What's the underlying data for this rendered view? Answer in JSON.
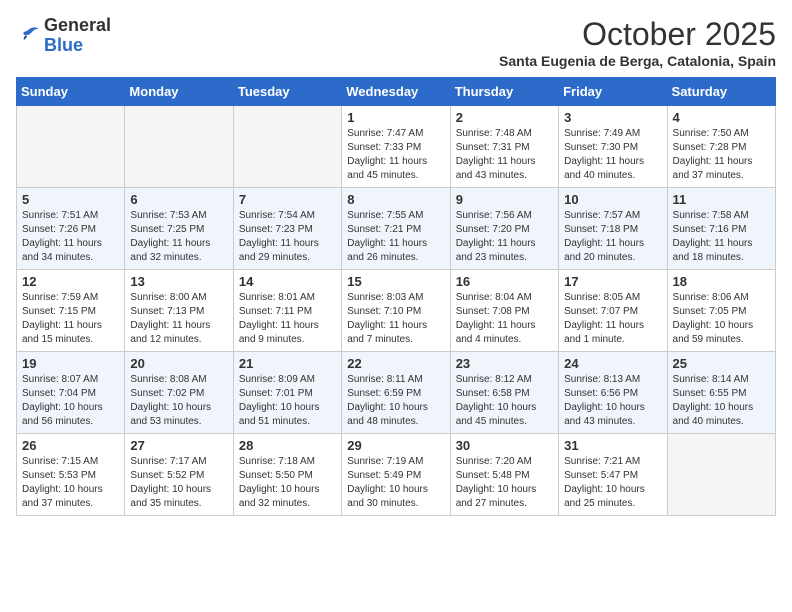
{
  "logo": {
    "line1": "General",
    "line2": "Blue"
  },
  "title": "October 2025",
  "subtitle": "Santa Eugenia de Berga, Catalonia, Spain",
  "weekdays": [
    "Sunday",
    "Monday",
    "Tuesday",
    "Wednesday",
    "Thursday",
    "Friday",
    "Saturday"
  ],
  "weeks": [
    [
      {
        "day": "",
        "info": ""
      },
      {
        "day": "",
        "info": ""
      },
      {
        "day": "",
        "info": ""
      },
      {
        "day": "1",
        "info": "Sunrise: 7:47 AM\nSunset: 7:33 PM\nDaylight: 11 hours\nand 45 minutes."
      },
      {
        "day": "2",
        "info": "Sunrise: 7:48 AM\nSunset: 7:31 PM\nDaylight: 11 hours\nand 43 minutes."
      },
      {
        "day": "3",
        "info": "Sunrise: 7:49 AM\nSunset: 7:30 PM\nDaylight: 11 hours\nand 40 minutes."
      },
      {
        "day": "4",
        "info": "Sunrise: 7:50 AM\nSunset: 7:28 PM\nDaylight: 11 hours\nand 37 minutes."
      }
    ],
    [
      {
        "day": "5",
        "info": "Sunrise: 7:51 AM\nSunset: 7:26 PM\nDaylight: 11 hours\nand 34 minutes."
      },
      {
        "day": "6",
        "info": "Sunrise: 7:53 AM\nSunset: 7:25 PM\nDaylight: 11 hours\nand 32 minutes."
      },
      {
        "day": "7",
        "info": "Sunrise: 7:54 AM\nSunset: 7:23 PM\nDaylight: 11 hours\nand 29 minutes."
      },
      {
        "day": "8",
        "info": "Sunrise: 7:55 AM\nSunset: 7:21 PM\nDaylight: 11 hours\nand 26 minutes."
      },
      {
        "day": "9",
        "info": "Sunrise: 7:56 AM\nSunset: 7:20 PM\nDaylight: 11 hours\nand 23 minutes."
      },
      {
        "day": "10",
        "info": "Sunrise: 7:57 AM\nSunset: 7:18 PM\nDaylight: 11 hours\nand 20 minutes."
      },
      {
        "day": "11",
        "info": "Sunrise: 7:58 AM\nSunset: 7:16 PM\nDaylight: 11 hours\nand 18 minutes."
      }
    ],
    [
      {
        "day": "12",
        "info": "Sunrise: 7:59 AM\nSunset: 7:15 PM\nDaylight: 11 hours\nand 15 minutes."
      },
      {
        "day": "13",
        "info": "Sunrise: 8:00 AM\nSunset: 7:13 PM\nDaylight: 11 hours\nand 12 minutes."
      },
      {
        "day": "14",
        "info": "Sunrise: 8:01 AM\nSunset: 7:11 PM\nDaylight: 11 hours\nand 9 minutes."
      },
      {
        "day": "15",
        "info": "Sunrise: 8:03 AM\nSunset: 7:10 PM\nDaylight: 11 hours\nand 7 minutes."
      },
      {
        "day": "16",
        "info": "Sunrise: 8:04 AM\nSunset: 7:08 PM\nDaylight: 11 hours\nand 4 minutes."
      },
      {
        "day": "17",
        "info": "Sunrise: 8:05 AM\nSunset: 7:07 PM\nDaylight: 11 hours\nand 1 minute."
      },
      {
        "day": "18",
        "info": "Sunrise: 8:06 AM\nSunset: 7:05 PM\nDaylight: 10 hours\nand 59 minutes."
      }
    ],
    [
      {
        "day": "19",
        "info": "Sunrise: 8:07 AM\nSunset: 7:04 PM\nDaylight: 10 hours\nand 56 minutes."
      },
      {
        "day": "20",
        "info": "Sunrise: 8:08 AM\nSunset: 7:02 PM\nDaylight: 10 hours\nand 53 minutes."
      },
      {
        "day": "21",
        "info": "Sunrise: 8:09 AM\nSunset: 7:01 PM\nDaylight: 10 hours\nand 51 minutes."
      },
      {
        "day": "22",
        "info": "Sunrise: 8:11 AM\nSunset: 6:59 PM\nDaylight: 10 hours\nand 48 minutes."
      },
      {
        "day": "23",
        "info": "Sunrise: 8:12 AM\nSunset: 6:58 PM\nDaylight: 10 hours\nand 45 minutes."
      },
      {
        "day": "24",
        "info": "Sunrise: 8:13 AM\nSunset: 6:56 PM\nDaylight: 10 hours\nand 43 minutes."
      },
      {
        "day": "25",
        "info": "Sunrise: 8:14 AM\nSunset: 6:55 PM\nDaylight: 10 hours\nand 40 minutes."
      }
    ],
    [
      {
        "day": "26",
        "info": "Sunrise: 7:15 AM\nSunset: 5:53 PM\nDaylight: 10 hours\nand 37 minutes."
      },
      {
        "day": "27",
        "info": "Sunrise: 7:17 AM\nSunset: 5:52 PM\nDaylight: 10 hours\nand 35 minutes."
      },
      {
        "day": "28",
        "info": "Sunrise: 7:18 AM\nSunset: 5:50 PM\nDaylight: 10 hours\nand 32 minutes."
      },
      {
        "day": "29",
        "info": "Sunrise: 7:19 AM\nSunset: 5:49 PM\nDaylight: 10 hours\nand 30 minutes."
      },
      {
        "day": "30",
        "info": "Sunrise: 7:20 AM\nSunset: 5:48 PM\nDaylight: 10 hours\nand 27 minutes."
      },
      {
        "day": "31",
        "info": "Sunrise: 7:21 AM\nSunset: 5:47 PM\nDaylight: 10 hours\nand 25 minutes."
      },
      {
        "day": "",
        "info": ""
      }
    ]
  ]
}
